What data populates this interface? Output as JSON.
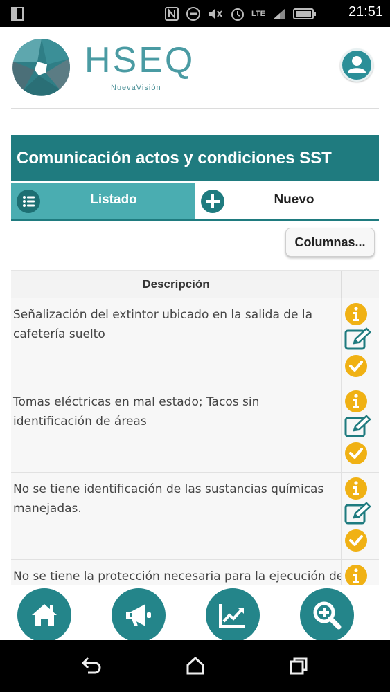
{
  "status_bar": {
    "time": "21:51",
    "network": "LTE",
    "icons": [
      "screen-icon",
      "nfc-icon",
      "block-icon",
      "mute-icon",
      "alarm-icon",
      "signal-icon",
      "battery-icon"
    ]
  },
  "header": {
    "logo_text": "HSEQ",
    "logo_subtitle": "NuevaVisión",
    "avatar_icon": "user-icon"
  },
  "title": "Comunicación actos y condiciones SST",
  "tabs": [
    {
      "label": "Listado",
      "icon": "list-icon",
      "active": true
    },
    {
      "label": "Nuevo",
      "icon": "plus-icon",
      "active": false
    }
  ],
  "columns_button": "Columnas...",
  "table": {
    "header": "Descripción",
    "rows": [
      {
        "descripcion": "Señalización del extintor ubicado en la salida de la cafetería suelto"
      },
      {
        "descripcion": "Tomas eléctricas en mal estado; Tacos sin identificación de áreas"
      },
      {
        "descripcion": "No se tiene identificación de las sustancias químicas manejadas."
      },
      {
        "descripcion": "No se tiene la protección necesaria para la ejecución de"
      }
    ],
    "row_actions": [
      "info-icon",
      "edit-icon",
      "check-icon"
    ]
  },
  "bottom_nav": [
    {
      "icon": "home-icon"
    },
    {
      "icon": "megaphone-icon"
    },
    {
      "icon": "chart-icon"
    },
    {
      "icon": "zoom-in-icon"
    }
  ],
  "system_nav": [
    "back-icon",
    "home-nav-icon",
    "recents-icon"
  ],
  "colors": {
    "primary": "#1f7b7f",
    "tab_active": "#4aadb1",
    "nav_button": "#24858a",
    "action_yellow": "#f0b114",
    "action_edit": "#1f7b7f"
  }
}
